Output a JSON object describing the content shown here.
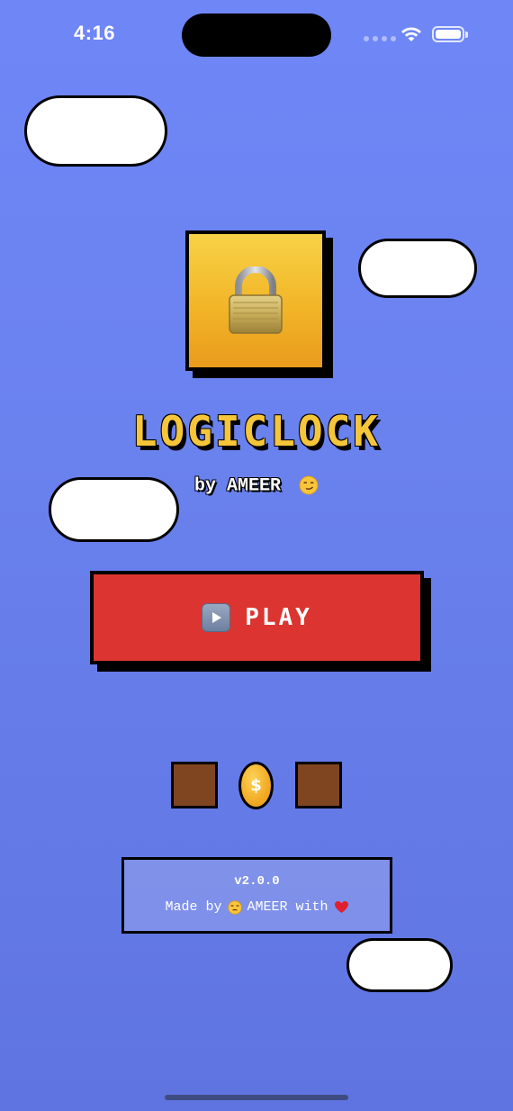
{
  "status_bar": {
    "time": "4:16"
  },
  "app": {
    "logo_icon": "padlock-icon",
    "title": "LOGICLOCK",
    "subtitle": "by AMEER",
    "subtitle_emoji": "smirking-face-icon"
  },
  "play_button": {
    "label": "PLAY",
    "icon": "play-button-icon"
  },
  "coin": {
    "symbol": "$"
  },
  "footer": {
    "version": "v2.0.0",
    "made_by_prefix": "Made by",
    "made_by_name": "AMEER with"
  },
  "colors": {
    "background": "#6a82ee",
    "play_button": "#dc3430",
    "title": "#f5c53a",
    "lock_tile": "#f2b528",
    "brown_tile": "#7e4520"
  }
}
